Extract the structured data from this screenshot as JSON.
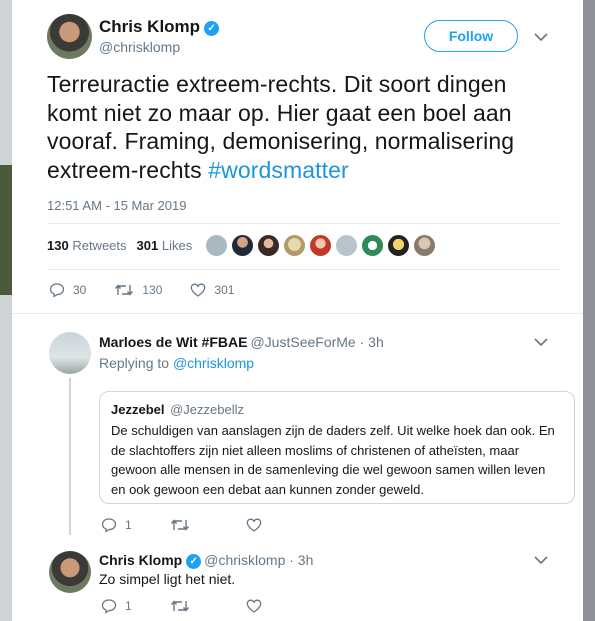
{
  "tweet": {
    "author_name": "Chris Klomp",
    "author_handle": "@chrisklomp",
    "follow_label": "Follow",
    "text_main": "Terreuractie extreem-rechts. Dit soort dingen komt niet zo maar op. Hier gaat een boel aan vooraf. Framing, demonisering, normalisering extreem-rechts ",
    "hashtag": "#wordsmatter",
    "timestamp": "12:51 AM - 15 Mar 2019",
    "retweets_count": "130",
    "retweets_label": "Retweets",
    "likes_count": "301",
    "likes_label": "Likes",
    "actions": {
      "replies": "30",
      "retweets": "130",
      "likes": "301"
    }
  },
  "replies": [
    {
      "author_name": "Marloes de Wit #FBAE",
      "author_handle": "@JustSeeForMe · 3h",
      "replying_prefix": "Replying to",
      "replying_to": "@chrisklomp",
      "quote": {
        "author_name": "Jezzebel",
        "author_handle": "@Jezzebellz",
        "text": "De schuldigen van aanslagen zijn de daders zelf. Uit welke hoek dan ook. En de slachtoffers zijn niet alleen moslims of christenen of atheïsten, maar gewoon alle mensen in de samenleving die wel gewoon samen willen leven en ook gewoon een debat aan kunnen zonder geweld."
      },
      "actions": {
        "replies": "1"
      }
    },
    {
      "author_name": "Chris Klomp",
      "author_handle": "@chrisklomp · 3h",
      "text": "Zo simpel ligt het niet.",
      "actions": {
        "replies": "1"
      }
    }
  ],
  "colors": {
    "accent": "#1da1f2",
    "link": "#1b95e0",
    "muted": "#657786"
  }
}
